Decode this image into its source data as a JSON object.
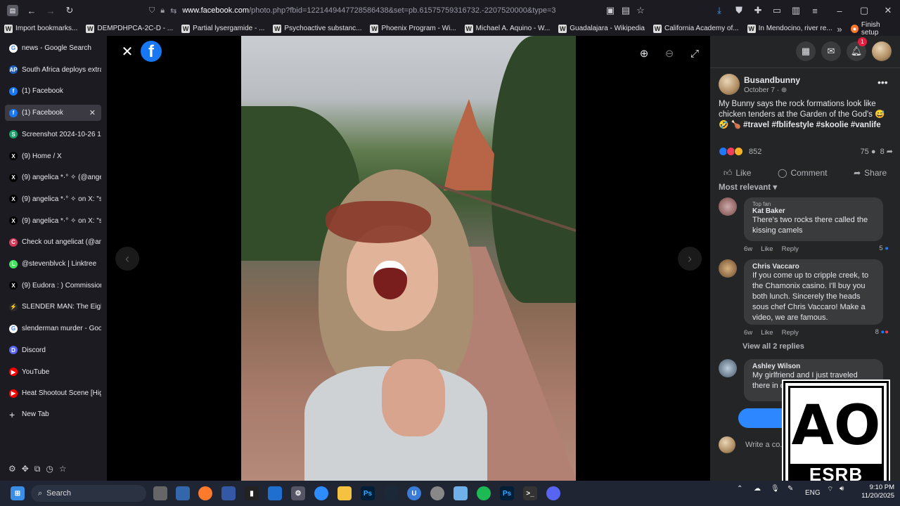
{
  "browser": {
    "url_host": "www.facebook.com",
    "url_path": "/photo.php?fbid=1221449447728586438&set=pb.61575759316732.-2207520000&type=3",
    "bookmarks": [
      {
        "label": "Import bookmarks...",
        "icon": "import-icon"
      },
      {
        "label": "DEMPDHPCA-2C-D - ...",
        "icon": "wikipedia-icon"
      },
      {
        "label": "Partial lysergamide - ...",
        "icon": "wikipedia-icon"
      },
      {
        "label": "Psychoactive substanc...",
        "icon": "wiki-icon"
      },
      {
        "label": "Phoenix Program - Wi...",
        "icon": "wikipedia-icon"
      },
      {
        "label": "Michael A. Aquino - W...",
        "icon": "wikipedia-icon"
      },
      {
        "label": "Guadalajara - Wikipedia",
        "icon": "wikipedia-icon"
      },
      {
        "label": "California Academy of...",
        "icon": "academy-icon"
      },
      {
        "label": "In Mendocino, river re...",
        "icon": "news-icon"
      }
    ],
    "finish_setup": "Finish setup"
  },
  "tabs": [
    {
      "label": "news - Google Search",
      "color": "#ffffff",
      "letter": "G"
    },
    {
      "label": "South Africa deploys extra",
      "color": "#1e5fc2",
      "letter": "AP"
    },
    {
      "label": "(1) Facebook",
      "color": "#1877f2",
      "letter": "f"
    },
    {
      "label": "(1) Facebook",
      "color": "#1877f2",
      "letter": "f",
      "active": true
    },
    {
      "label": "Screenshot 2024-10-26 12",
      "color": "#19a06a",
      "letter": "S"
    },
    {
      "label": "(9) Home / X",
      "color": "#000000",
      "letter": "X"
    },
    {
      "label": "(9) angelica *·° ✧ (@angel",
      "color": "#000000",
      "letter": "X"
    },
    {
      "label": "(9) angelica *·° ✧ on X: \"sa",
      "color": "#000000",
      "letter": "X"
    },
    {
      "label": "(9) angelica *·° ✧ on X: \"sa",
      "color": "#000000",
      "letter": "X"
    },
    {
      "label": "Check out angelicat (@ang",
      "color": "#d63a5a",
      "letter": "C"
    },
    {
      "label": "@stevenblvck | Linktree",
      "color": "#43e55e",
      "letter": "L"
    },
    {
      "label": "(9) Eudora : ) Commission",
      "color": "#000000",
      "letter": "X"
    },
    {
      "label": "SLENDER MAN: The Eight",
      "color": "#2a2a2a",
      "letter": "⚡"
    },
    {
      "label": "slenderman murder - Goo",
      "color": "#ffffff",
      "letter": "G"
    },
    {
      "label": "Discord",
      "color": "#5865f2",
      "letter": "D"
    },
    {
      "label": "YouTube",
      "color": "#ff0000",
      "letter": "▶"
    },
    {
      "label": "Heat Shootout Scene [Hig",
      "color": "#ff0000",
      "letter": "▶"
    }
  ],
  "new_tab": "New Tab",
  "viewer": {
    "logo_letter": "f"
  },
  "post": {
    "author": "Busandbunny",
    "date": "October 7 ·",
    "caption": "My Bunny says the rock formations look like chicken tenders at the Garden of the God's 😅 🤣 🍗",
    "hashtags": "#travel #fblifestyle #skoolie #vanlife",
    "reaction_count": "852",
    "comment_count": "75",
    "share_count": "8",
    "like_label": "Like",
    "comment_label": "Comment",
    "share_label": "Share",
    "sort_label": "Most relevant"
  },
  "comments": [
    {
      "badge": "Top fan",
      "name": "Kat Baker",
      "text": "There's two rocks there called the kissing camels",
      "age": "6w",
      "like": "Like",
      "reply": "Reply",
      "reactions": "5"
    },
    {
      "badge": "",
      "name": "Chris Vaccaro",
      "text": "If you come up to cripple creek, to the Chamonix casino. I'll buy you both lunch. Sincerely the heads sous chef Chris Vaccaro! Make a video, we are famous.",
      "age": "6w",
      "like": "Like",
      "reply": "Reply",
      "reactions": "8"
    },
    {
      "badge": "",
      "name": "Ashley Wilson",
      "text": "My girlfriend and I just traveled there in ou... look like ch...",
      "age": "",
      "like": "",
      "reply": "",
      "reactions": ""
    }
  ],
  "view_replies": "View all 2 replies",
  "write_placeholder": "Write a co...",
  "esrb": {
    "rating": "AO",
    "brand": "ESRB"
  },
  "taskbar": {
    "search": "Search",
    "lang": "ENG",
    "time": "9:10 PM",
    "date": "11/20/2025"
  }
}
